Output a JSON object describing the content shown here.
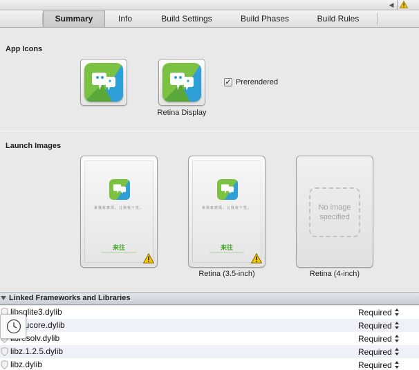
{
  "tabs": [
    {
      "label": "Summary",
      "selected": true
    },
    {
      "label": "Info",
      "selected": false
    },
    {
      "label": "Build Settings",
      "selected": false
    },
    {
      "label": "Build Phases",
      "selected": false
    },
    {
      "label": "Build Rules",
      "selected": false
    }
  ],
  "app_icons": {
    "title": "App Icons",
    "retina_caption": "Retina Display",
    "prerendered_label": "Prerendered",
    "prerendered_checked": true
  },
  "launch_images": {
    "title": "Launch Images",
    "items": [
      {
        "caption": "",
        "has_image": true,
        "warning": true
      },
      {
        "caption": "Retina (3.5-inch)",
        "has_image": true,
        "warning": true
      },
      {
        "caption": "Retina (4-inch)",
        "has_image": false,
        "placeholder": "No image specified"
      }
    ],
    "tagline": "来我有表情，让我有个性。",
    "brand": "来往"
  },
  "frameworks": {
    "title": "Linked Frameworks and Libraries",
    "rows": [
      {
        "name": "libsqlite3.dylib",
        "status": "Required"
      },
      {
        "name": "libicucore.dylib",
        "status": "Required"
      },
      {
        "name": "libresolv.dylib",
        "status": "Required"
      },
      {
        "name": "libz.1.2.5.dylib",
        "status": "Required"
      },
      {
        "name": "libz.dylib",
        "status": "Required"
      }
    ]
  },
  "colors": {
    "icon_green": "#7cc242",
    "icon_blue": "#2f9fd8",
    "warning_yellow": "#f5c400"
  }
}
